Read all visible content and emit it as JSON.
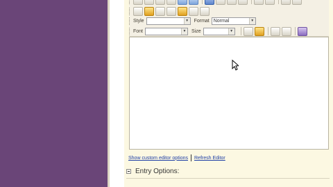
{
  "toolbar": {
    "style_label": "Style",
    "style_value": "",
    "format_label": "Format",
    "format_value": "Normal",
    "font_label": "Font",
    "font_value": "",
    "size_label": "Size",
    "size_value": ""
  },
  "links": {
    "custom_options": "Show custom editor options",
    "refresh": "Refresh Editor"
  },
  "section": {
    "title": "Entry Options:"
  },
  "colors": {
    "left_panel": "#6a4578",
    "content_bg": "#fcf8e2",
    "link": "#1f3fa6"
  }
}
